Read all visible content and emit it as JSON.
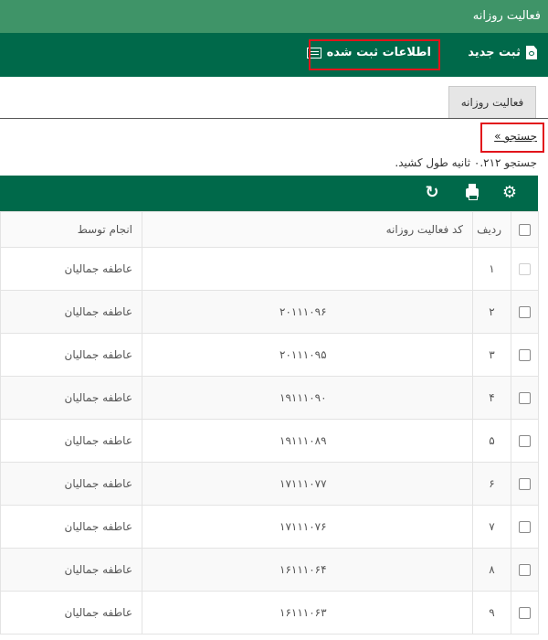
{
  "window": {
    "title": "فعالیت روزانه"
  },
  "toolbar": {
    "new_label": "ثبت جدید",
    "registered_label": "اطلاعات ثبت شده"
  },
  "tabs": [
    {
      "label": "فعالیت روزانه",
      "active": true
    }
  ],
  "search": {
    "link_label": "جستجو »",
    "time_text": "جستجو ۰.۲۱۲ ثانیه طول کشید."
  },
  "grid": {
    "actions": [
      "gear-icon",
      "printer-icon",
      "refresh-icon"
    ],
    "columns": [
      "ردیف",
      "کد فعالیت روزانه",
      "انجام توسط"
    ],
    "rows": [
      {
        "row_num": "۱",
        "code": "",
        "performed_by": "عاطفه جمالیان"
      },
      {
        "row_num": "۲",
        "code": "۲۰۱۱۱۰۹۶",
        "performed_by": "عاطفه جمالیان"
      },
      {
        "row_num": "۳",
        "code": "۲۰۱۱۱۰۹۵",
        "performed_by": "عاطفه جمالیان"
      },
      {
        "row_num": "۴",
        "code": "۱۹۱۱۱۰۹۰",
        "performed_by": "عاطفه جمالیان"
      },
      {
        "row_num": "۵",
        "code": "۱۹۱۱۱۰۸۹",
        "performed_by": "عاطفه جمالیان"
      },
      {
        "row_num": "۶",
        "code": "۱۷۱۱۱۰۷۷",
        "performed_by": "عاطفه جمالیان"
      },
      {
        "row_num": "۷",
        "code": "۱۷۱۱۱۰۷۶",
        "performed_by": "عاطفه جمالیان"
      },
      {
        "row_num": "۸",
        "code": "۱۶۱۱۱۰۶۴",
        "performed_by": "عاطفه جمالیان"
      },
      {
        "row_num": "۹",
        "code": "۱۶۱۱۱۰۶۳",
        "performed_by": "عاطفه جمالیان"
      }
    ]
  },
  "colors": {
    "titlebar": "#3f9468",
    "toolbar": "#00694a",
    "highlight": "#e2141b"
  }
}
